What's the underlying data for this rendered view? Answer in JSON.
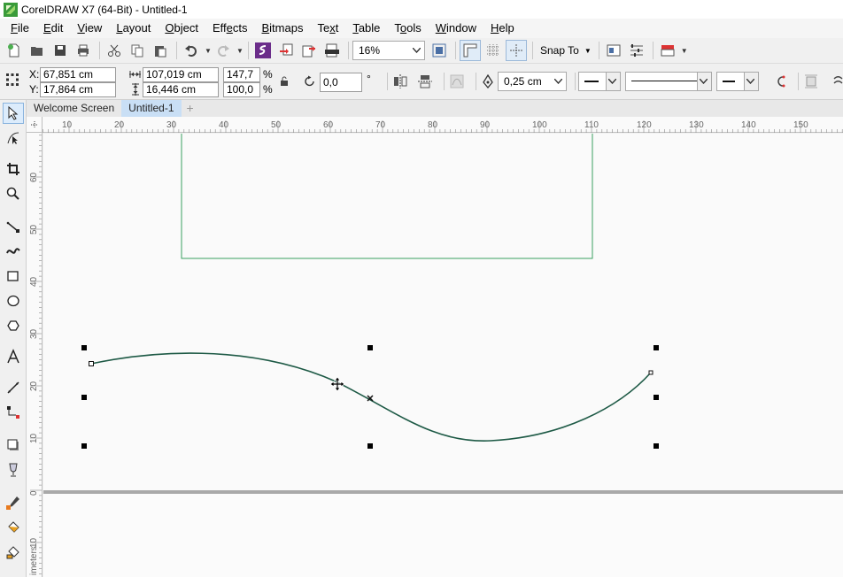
{
  "titlebar": {
    "title": "CorelDRAW X7 (64-Bit) - Untitled-1",
    "icon": "coreldraw-app-icon"
  },
  "menu": [
    {
      "pre": "",
      "u": "F",
      "post": "ile"
    },
    {
      "pre": "",
      "u": "E",
      "post": "dit"
    },
    {
      "pre": "",
      "u": "V",
      "post": "iew"
    },
    {
      "pre": "",
      "u": "L",
      "post": "ayout"
    },
    {
      "pre": "",
      "u": "O",
      "post": "bject"
    },
    {
      "pre": "Eff",
      "u": "e",
      "post": "cts"
    },
    {
      "pre": "",
      "u": "B",
      "post": "itmaps"
    },
    {
      "pre": "Te",
      "u": "x",
      "post": "t"
    },
    {
      "pre": "",
      "u": "T",
      "post": "able"
    },
    {
      "pre": "T",
      "u": "o",
      "post": "ols"
    },
    {
      "pre": "",
      "u": "W",
      "post": "indow"
    },
    {
      "pre": "",
      "u": "H",
      "post": "elp"
    }
  ],
  "std_toolbar": {
    "zoom": "16%",
    "snap_to": "Snap To"
  },
  "property_bar": {
    "x_label": "X:",
    "x_value": "67,851 cm",
    "y_label": "Y:",
    "y_value": "17,864 cm",
    "width_value": "107,019 cm",
    "height_value": "16,446 cm",
    "scale_w": "147,7",
    "scale_h": "100,0",
    "pct_1": "%",
    "pct_2": "%",
    "rotation": "0,0",
    "degree": "°",
    "outline_width": "0,25 cm"
  },
  "tabs": [
    {
      "label": "Welcome Screen",
      "active": false
    },
    {
      "label": "Untitled-1",
      "active": true
    }
  ],
  "rulers": {
    "h_labels": [
      "10",
      "20",
      "30",
      "40",
      "50",
      "60",
      "70",
      "80",
      "90",
      "100",
      "110",
      "120",
      "130",
      "140",
      "150"
    ],
    "v_labels": [
      "60",
      "50",
      "40",
      "30",
      "20",
      "10",
      "0",
      "10"
    ],
    "v_unit": "imeters"
  },
  "colors": {
    "curve": "#1e5a46",
    "page_border": "#3aa060",
    "selection": "#000000"
  }
}
